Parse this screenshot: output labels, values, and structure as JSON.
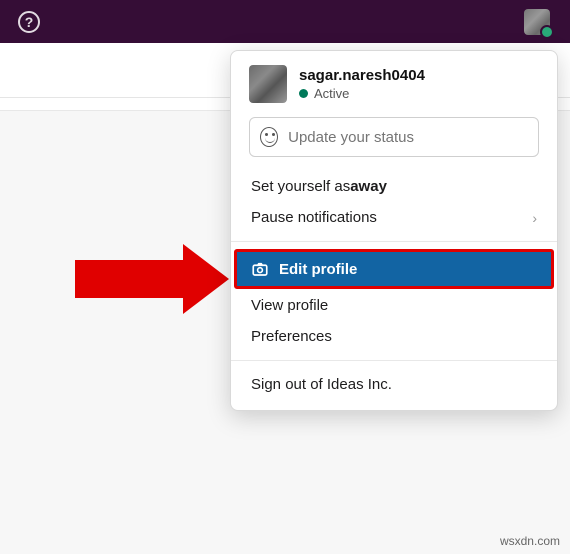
{
  "header": {
    "help_label": "?"
  },
  "user": {
    "name": "sagar.naresh0404",
    "status_text": "Active"
  },
  "status_input": {
    "placeholder": "Update your status"
  },
  "menu": {
    "set_away_prefix": "Set yourself as ",
    "set_away_bold": "away",
    "pause_notifications": "Pause notifications",
    "edit_profile": "Edit profile",
    "view_profile": "View profile",
    "preferences": "Preferences",
    "sign_out": "Sign out of Ideas Inc."
  },
  "watermark": "wsxdn.com"
}
